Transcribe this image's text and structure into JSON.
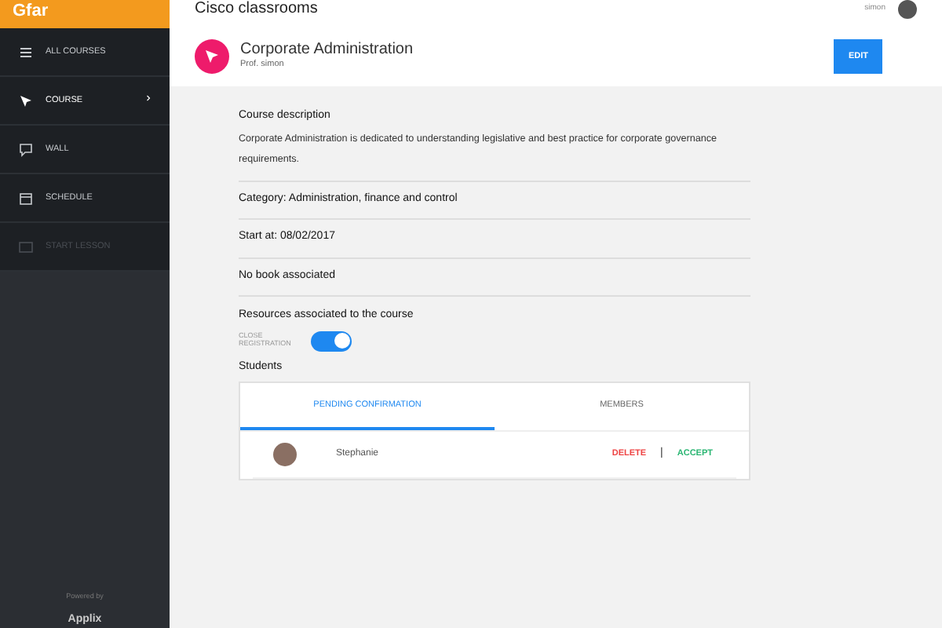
{
  "sidebar": {
    "logo": "Gfar",
    "items": [
      {
        "label": "ALL COURSES",
        "selected": false,
        "disabled": false,
        "has_submenu": false
      },
      {
        "label": "COURSE",
        "selected": true,
        "disabled": false,
        "has_submenu": true
      },
      {
        "label": "WALL",
        "selected": false,
        "disabled": false,
        "has_submenu": false
      },
      {
        "label": "SCHEDULE",
        "selected": false,
        "disabled": false,
        "has_submenu": false
      },
      {
        "label": "START LESSON",
        "selected": false,
        "disabled": true,
        "has_submenu": false
      }
    ],
    "footer": {
      "powered_by": "Powered by",
      "brand": "Applix"
    }
  },
  "header": {
    "title": "Cisco classrooms",
    "user": "simon"
  },
  "course": {
    "title": "Corporate Administration",
    "teacher": "Prof. simon",
    "edit_button": "EDIT"
  },
  "details": {
    "description_title": "Course description",
    "description": "Corporate Administration is dedicated to understanding legislative and best practice for corporate governance requirements.",
    "rows": [
      "Category: Administration, finance and control",
      "Start at: 08/02/2017",
      "No book associated"
    ],
    "resources_title": "Resources associated to the course",
    "toggle": {
      "label": "CLOSE REGISTRATION",
      "on": true
    }
  },
  "students": {
    "title": "Students",
    "tabs": [
      {
        "label": "PENDING CONFIRMATION",
        "selected": true
      },
      {
        "label": "MEMBERS",
        "selected": false
      }
    ],
    "rows": [
      {
        "name": "Stephanie",
        "delete": "DELETE",
        "separator": "|",
        "accept": "ACCEPT"
      }
    ]
  }
}
